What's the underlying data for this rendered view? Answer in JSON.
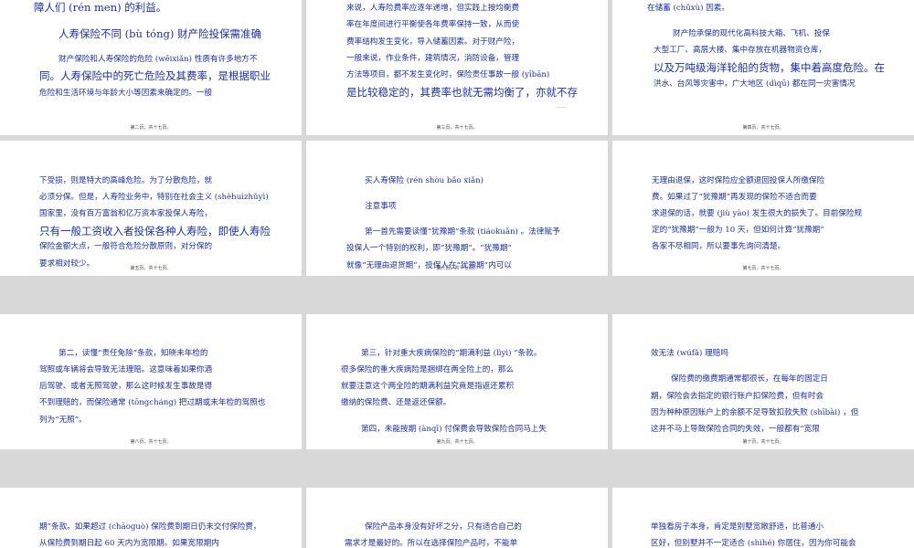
{
  "slides": [
    {
      "lines": [
        {
          "t": "障人们 (rén men) 的利益。",
          "s": "big"
        },
        {
          "t": "人寿保险不同 (bù tóng) 财产险投保需准确",
          "s": "big"
        },
        {
          "t": "财产保险和人寿保险的危险 (wēixiǎn) 性质有许多地方不",
          "s": "small"
        },
        {
          "t": "同。人寿保险中的死亡危险及其费率，是根据职业",
          "s": "big"
        },
        {
          "t": "危险和生活环境与年龄大小等因素来确定的。一般",
          "s": "small"
        }
      ],
      "footer": "第二页，共十七页。"
    },
    {
      "lines": [
        {
          "t": "来说，人寿险费率应逐年递增，但实践上按均衡费",
          "s": "small"
        },
        {
          "t": "率在年度间进行平衡使各年费率保持一致，从而使",
          "s": "small"
        },
        {
          "t": "费率结构发生变化，导入储蓄因素。对于财产险，",
          "s": "small"
        },
        {
          "t": "一般来说，作业条件，建筑情况，消防设备，管理",
          "s": "small"
        },
        {
          "t": "方法等项目，都不发生变化时，保险责任事故一般 (yībān)",
          "s": "small"
        },
        {
          "t": "是比较稳定的，其费率也就无需均衡了，亦就不存",
          "s": "big"
        }
      ],
      "footer": "第三页，共十七页。"
    },
    {
      "lines": [
        {
          "t": "在储蓄 (chǔxù) 因素。",
          "s": "small"
        },
        {
          "t": "财产险承保的现代化高科技大箱、飞机、投保",
          "s": "small"
        },
        {
          "t": "大型工厂、高层大楼、集中存放在机器物资仓库，",
          "s": "small"
        },
        {
          "t": "以及万吨级海洋轮船的货物，集中着高度危险。在",
          "s": "big"
        },
        {
          "t": "洪水、台风等灾害中，广大地区 (dìqū) 都在同一灾害情况",
          "s": "small"
        }
      ],
      "footer": "第四页，共十七页。"
    },
    {
      "lines": [
        {
          "t": "下受损，则是特大的高峰危险。为了分散危险，就",
          "s": "small"
        },
        {
          "t": "必须分保。但是，人寿险业务中，特别在社会主义 (shèhuìzhǔyì)",
          "s": "small"
        },
        {
          "t": "国家里，没有百万富翁和亿万资本家投保人寿险，",
          "s": "small"
        },
        {
          "t": "只有一般工资收入者投保各种人寿险，即使人寿险",
          "s": "big"
        },
        {
          "t": "保险金额大点，一般符合危险分散原则，对分保的",
          "s": "small"
        },
        {
          "t": "要求相对较少。",
          "s": "small"
        }
      ],
      "footer": "第五页，共十七页。"
    },
    {
      "lines": [
        {
          "t": "买人寿保险 (rén shòu bǎo xiǎn)",
          "s": "small"
        },
        {
          "t": "注意事项",
          "s": "small"
        },
        {
          "t": "第一首先需要读懂“犹豫期”条款 (tiáokuǎn) 。法律赋予",
          "s": "small"
        },
        {
          "t": "投保人一个特别的权利，即“犹豫期”。“犹豫期”",
          "s": "small"
        },
        {
          "t": "就像“无理由退货期”，投保人在“犹豫期”内可以",
          "s": "small"
        }
      ],
      "footer": "第六页，共十七页。"
    },
    {
      "lines": [
        {
          "t": "无理由退保，这时保险应全额退回投保人所缴保险",
          "s": "small"
        },
        {
          "t": "费。如果过了“犹豫期”再发现的保险不适合而要",
          "s": "small"
        },
        {
          "t": "求退保的话，就要 (jiù yào) 发生很大的损失了。目前保险规",
          "s": "small"
        },
        {
          "t": "定的“犹豫期”一般为 10 天，但如何计算“犹豫期”",
          "s": "small"
        },
        {
          "t": "各家不尽相同，所以要事先询问清楚。",
          "s": "small"
        }
      ],
      "footer": "第七页，共十七页。"
    },
    {
      "lines": [
        {
          "t": "第二，读懂“责任免除”条款，知晓未年检的",
          "s": "small"
        },
        {
          "t": "驾照或车辆将会导致无法理赔。这意味着如果你酒",
          "s": "small"
        },
        {
          "t": "后驾驶、或者无照驾驶，那么这时候发生事故是得",
          "s": "small"
        },
        {
          "t": "不到理赔的，而保险通常 (tōngcháng) 把过期或未年检的驾照也",
          "s": "small"
        },
        {
          "t": "列为“无照”。",
          "s": "small"
        }
      ],
      "footer": "第八页，共十七页。"
    },
    {
      "lines": [
        {
          "t": "第三，针对重大疾病保险的“期满利益 (lìyì) ”条款。",
          "s": "small"
        },
        {
          "t": "很多保险的重大疾病险是捆绑在两全险上的，那么",
          "s": "small"
        },
        {
          "t": "就要注意这个两全险的期满利益究竟是指返还累积",
          "s": "small"
        },
        {
          "t": "缴纳的保险费、还是返还保额。",
          "s": "small"
        },
        {
          "t": "第四，未能按期 (ànqī) 付保费会导致保险合同马上失",
          "s": "small"
        }
      ],
      "footer": "第九页，共十七页。"
    },
    {
      "lines": [
        {
          "t": "效无法 (wúfǎ) 理赔吗",
          "s": "small"
        },
        {
          "t": "保险费的缴费期通常都很长，在每年的固定日",
          "s": "small"
        },
        {
          "t": "期，保险会去指定的银行账户扣保险费，但有时会",
          "s": "small"
        },
        {
          "t": "因为种种原因账户上的余额不足导致扣款失败 (shībài) ，但",
          "s": "small"
        },
        {
          "t": "这并不马上导致保险合同的失效，一般都有“宽限",
          "s": "small"
        }
      ],
      "footer": "第十页，共十七页。"
    },
    {
      "lines": [
        {
          "t": "期”条款。如果超过 (chāoguò) 保险费到期日仍未交付保险费，",
          "s": "small"
        },
        {
          "t": "从保险费到期日起 60 天内为宽限期。如果宽限期内",
          "s": "small"
        }
      ],
      "footer": ""
    },
    {
      "lines": [
        {
          "t": "保险产品本身没有好坏之分，只有适合自己的",
          "s": "small"
        },
        {
          "t": "需求才是最好的。所以在选择保险产品时，不能单",
          "s": "small"
        }
      ],
      "footer": ""
    },
    {
      "lines": [
        {
          "t": "单独看房子本身，肯定是别墅宽敞舒适，比普通小",
          "s": "small"
        },
        {
          "t": "区好，但别墅并不一定适合 (shìhé) 你居住，因为你可能会",
          "s": "small"
        }
      ],
      "footer": ""
    }
  ]
}
